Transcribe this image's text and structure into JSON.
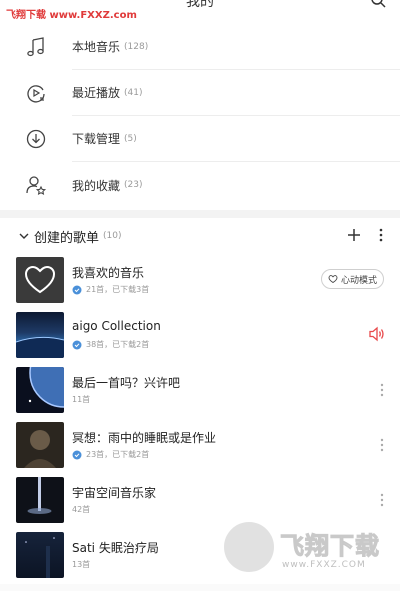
{
  "header": {
    "title": "我的"
  },
  "watermark": {
    "top_text": "飞翔下载 www.FXXZ.com",
    "logo_text": "飞翔下载",
    "logo_url": "www.FXXZ.COM"
  },
  "menu": [
    {
      "label": "本地音乐",
      "count": "(128)",
      "icon": "music-note-icon"
    },
    {
      "label": "最近播放",
      "count": "(41)",
      "icon": "recent-play-icon"
    },
    {
      "label": "下载管理",
      "count": "(5)",
      "icon": "download-icon"
    },
    {
      "label": "我的收藏",
      "count": "(23)",
      "icon": "user-star-icon"
    }
  ],
  "playlists_section": {
    "title": "创建的歌单",
    "count": "(10)"
  },
  "playlists": [
    {
      "name": "我喜欢的音乐",
      "meta": "21首，已下载3首",
      "downloaded": true,
      "action": "心动模式"
    },
    {
      "name": "aigo Collection",
      "meta": "38首，已下载2首",
      "downloaded": true,
      "playing": true
    },
    {
      "name": "最后一首吗？兴许吧",
      "meta": "11首",
      "downloaded": false
    },
    {
      "name": "冥想：雨中的睡眠或是作业",
      "meta": "23首，已下载2首",
      "downloaded": true
    },
    {
      "name": "宇宙空间音乐家",
      "meta": "42首",
      "downloaded": false
    },
    {
      "name": "Sati 失眠治疗局",
      "meta": "13首",
      "downloaded": false
    }
  ],
  "colors": {
    "accent_red": "#e8484a",
    "download_blue": "#4a90d9",
    "text_gray": "#9a9a9a"
  }
}
